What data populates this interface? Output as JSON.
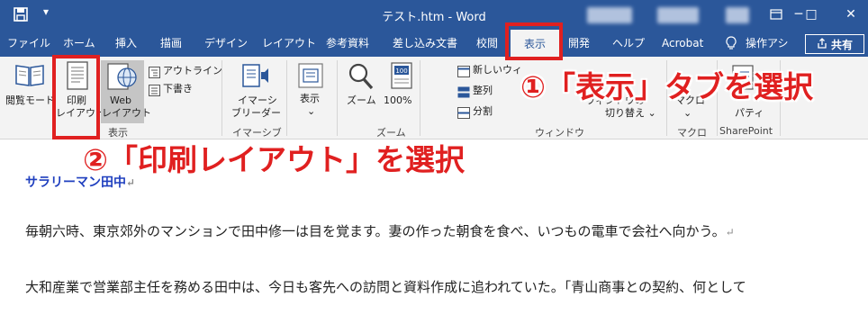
{
  "window": {
    "title": "テスト.htm",
    "separator": " - ",
    "app_name": "Word",
    "qat_more": "▾",
    "min": "─",
    "restore": "❐",
    "max": "□",
    "close": "✕"
  },
  "tabs": [
    "ファイル",
    "ホーム",
    "挿入",
    "描画",
    "デザイン",
    "レイアウト",
    "参考資料",
    "差し込み文書",
    "校閲",
    "表示",
    "開発",
    "ヘルプ",
    "Acrobat",
    "操作アシ"
  ],
  "active_tab": "表示",
  "share_label": "共有",
  "ribbon": {
    "views": {
      "read_mode": "閲覧モード",
      "print_layout_1": "印刷",
      "print_layout_2": "レイアウト",
      "web_layout_1": "Web",
      "web_layout_2": "レイアウト",
      "outline": "アウトライン",
      "draft": "下書き",
      "group": "表示"
    },
    "immersive": {
      "reader_1": "イマーシ",
      "reader_2": "ブリーダー",
      "group": "イマーシブ"
    },
    "show": {
      "label": "表示",
      "caret": "⌄"
    },
    "zoom": {
      "zoom": "ズーム",
      "percent": "100%",
      "group": "ズーム"
    },
    "window": {
      "new_window": "新しいウィ",
      "arrange": "整列",
      "split": "分割",
      "switch_1": "ウィンドウの",
      "switch_2": "切り替え ⌄",
      "group": "ウィンドウ"
    },
    "macro": {
      "label": "マクロ",
      "caret": "⌄",
      "group": "マクロ"
    },
    "sharepoint": {
      "props": "パティ",
      "group": "SharePoint"
    }
  },
  "document": {
    "heading": "サラリーマン田中",
    "para1": "毎朝六時、東京郊外のマンションで田中修一は目を覚ます。妻の作った朝食を食べ、いつもの電車で会社へ向かう。",
    "para2": "大和産業で営業部主任を務める田中は、今日も客先への訪問と資料作成に追われていた。「青山商事との契約、何として",
    "mark": "↵"
  },
  "annotations": {
    "step1": "①「表示」タブを選択",
    "step2": "②「印刷レイアウト」を選択"
  },
  "colors": {
    "word_blue": "#2b579a",
    "annotation_red": "#e02020",
    "heading_blue": "#1f3fbf"
  }
}
